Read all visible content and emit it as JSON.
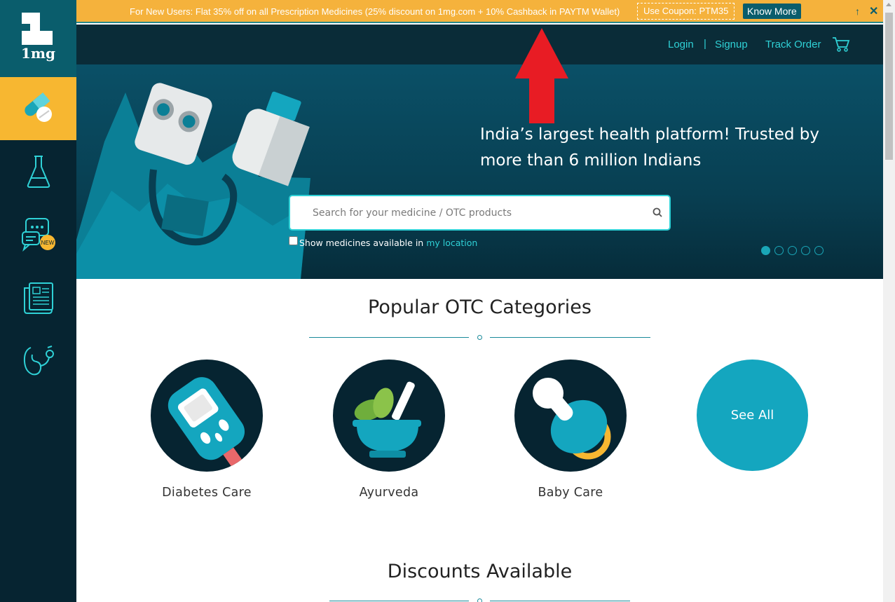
{
  "brand": {
    "logo_text": "1mg"
  },
  "offer_bar": {
    "text": "For New Users: Flat 35% off on all Prescription Medicines (25% discount on 1mg.com + 10% Cashback in PAYTM Wallet)",
    "coupon": "Use Coupon: PTM35",
    "know_more": "Know More",
    "up_icon": "↑",
    "close_icon": "✕"
  },
  "header": {
    "login": "Login",
    "separator": "|",
    "signup": "Signup",
    "track_order": "Track Order"
  },
  "sidebar": {
    "items": [
      {
        "name": "medicines",
        "icon": "pill-icon",
        "active": true
      },
      {
        "name": "lab-tests",
        "icon": "flask-icon",
        "active": false
      },
      {
        "name": "consult",
        "icon": "chat-icon",
        "badge": "NEW",
        "active": false
      },
      {
        "name": "articles",
        "icon": "news-icon",
        "active": false
      },
      {
        "name": "health",
        "icon": "stethoscope-icon",
        "active": false
      }
    ]
  },
  "hero": {
    "title": "India’s largest health platform! Trusted by more than 6 million Indians",
    "search_placeholder": "Search for your medicine / OTC products",
    "location_text": "Show medicines available in",
    "location_link": "my location",
    "slides": 5,
    "active_slide": 1
  },
  "popular": {
    "title": "Popular OTC Categories",
    "categories": [
      {
        "label": "Diabetes Care",
        "icon": "glucometer-icon"
      },
      {
        "label": "Ayurveda",
        "icon": "mortar-pestle-icon"
      },
      {
        "label": "Baby Care",
        "icon": "pacifier-icon"
      }
    ],
    "see_all": "See All"
  },
  "discounts": {
    "title": "Discounts Available"
  },
  "colors": {
    "sidebar_bg": "#062431",
    "accent_yellow": "#f7b731",
    "accent_teal": "#2fd1d6",
    "hero_bg": "#0a5067",
    "see_all_bg": "#14a6bf"
  }
}
